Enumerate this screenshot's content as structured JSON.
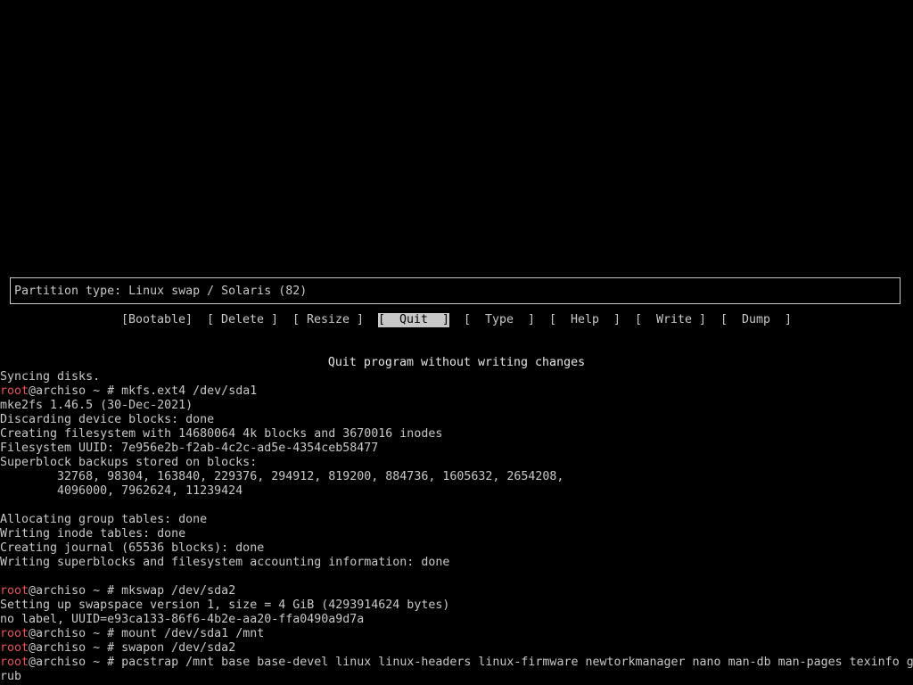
{
  "colors": {
    "background": "#000000",
    "foreground": "#c8c8c8",
    "prompt_user": "#e8505b",
    "selected_bg": "#c8c8c8"
  },
  "partition_type": "Partition type: Linux swap / Solaris (82)",
  "menu": {
    "selected": "Quit",
    "buttons": [
      {
        "label": "[Bootable]"
      },
      {
        "label": "[ Delete ]"
      },
      {
        "label": "[ Resize ]"
      },
      {
        "label": "[  Quit  ]"
      },
      {
        "label": "[  Type  ]"
      },
      {
        "label": "[  Help  ]"
      },
      {
        "label": "[  Write ]"
      },
      {
        "label": "[  Dump  ]"
      }
    ]
  },
  "hint": "Quit program without writing changes",
  "terminal": {
    "prompt_user": "root",
    "lines": [
      {
        "text": "Syncing disks."
      },
      {
        "prompt": " ~ # ",
        "host": "@archiso",
        "text": "mkfs.ext4 /dev/sda1"
      },
      {
        "text": "mke2fs 1.46.5 (30-Dec-2021)"
      },
      {
        "text": "Discarding device blocks: done"
      },
      {
        "text": "Creating filesystem with 14680064 4k blocks and 3670016 inodes"
      },
      {
        "text": "Filesystem UUID: 7e956e2b-f2ab-4c2c-ad5e-4354ceb58477"
      },
      {
        "text": "Superblock backups stored on blocks:"
      },
      {
        "text": "        32768, 98304, 163840, 229376, 294912, 819200, 884736, 1605632, 2654208,"
      },
      {
        "text": "        4096000, 7962624, 11239424"
      },
      {
        "text": ""
      },
      {
        "text": "Allocating group tables: done"
      },
      {
        "text": "Writing inode tables: done"
      },
      {
        "text": "Creating journal (65536 blocks): done"
      },
      {
        "text": "Writing superblocks and filesystem accounting information: done"
      },
      {
        "text": ""
      },
      {
        "prompt": " ~ # ",
        "host": "@archiso",
        "text": "mkswap /dev/sda2"
      },
      {
        "text": "Setting up swapspace version 1, size = 4 GiB (4293914624 bytes)"
      },
      {
        "text": "no label, UUID=e93ca133-86f6-4b2e-aa20-ffa0490a9d7a"
      },
      {
        "prompt": " ~ # ",
        "host": "@archiso",
        "text": "mount /dev/sda1 /mnt"
      },
      {
        "prompt": " ~ # ",
        "host": "@archiso",
        "text": "swapon /dev/sda2"
      },
      {
        "prompt": " ~ # ",
        "host": "@archiso",
        "text": "pacstrap /mnt base base-devel linux linux-headers linux-firmware newtorkmanager nano man-db man-pages texinfo g"
      },
      {
        "text": "rub"
      }
    ]
  }
}
